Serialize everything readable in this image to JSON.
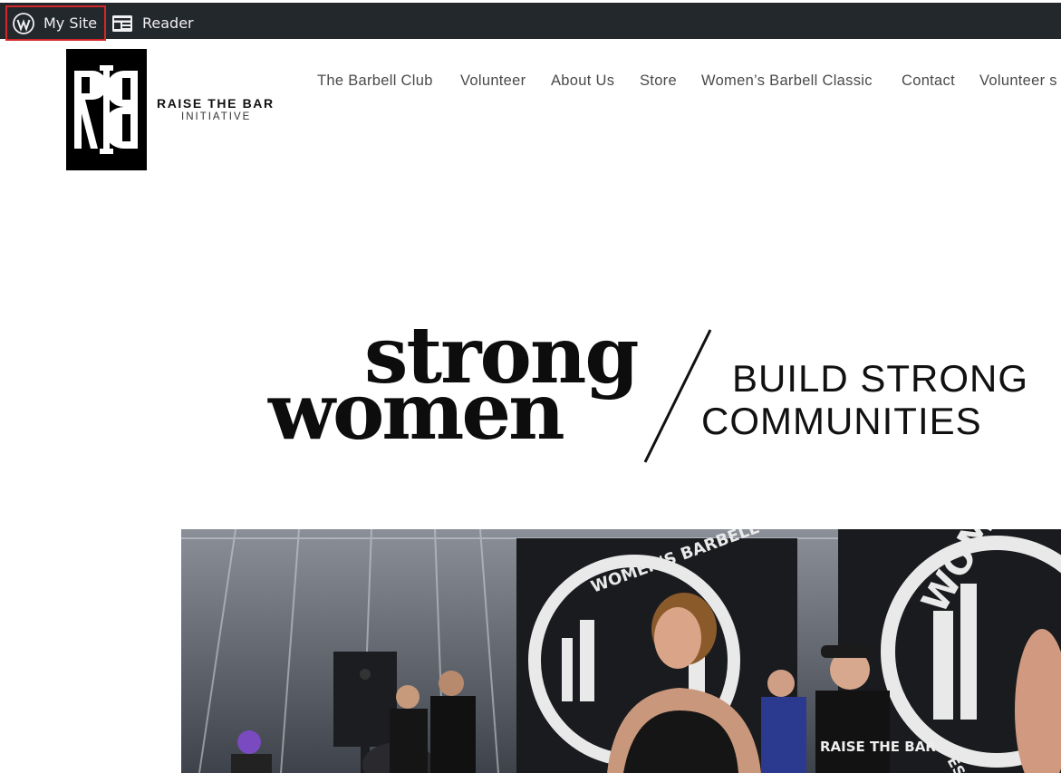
{
  "admin_bar": {
    "my_site_label": "My Site",
    "reader_label": "Reader",
    "icons": [
      "wordpress-icon",
      "reader-icon"
    ],
    "highlight_color": "#d42727"
  },
  "logo": {
    "monogram": "RTB",
    "line1": "RAISE THE BAR",
    "line2": "INITIATIVE"
  },
  "nav": {
    "items": [
      "The Barbell Club",
      "Volunteer",
      "About Us",
      "Store",
      "Women’s Barbell Classic",
      "Contact",
      "Volunteer s"
    ]
  },
  "hero": {
    "word1": "strong",
    "word2": "women",
    "line1": "BUILD STRONG",
    "line2": "COMMUNITIES"
  },
  "photo": {
    "banner_text": "WOMEN'S BARBELL",
    "shirt_text": "RAISE THE BAR",
    "corner_text": "WOM",
    "est_text": "EST"
  },
  "colors": {
    "admin_bar_bg": "#23282d",
    "text_dark": "#0d0d0d"
  }
}
